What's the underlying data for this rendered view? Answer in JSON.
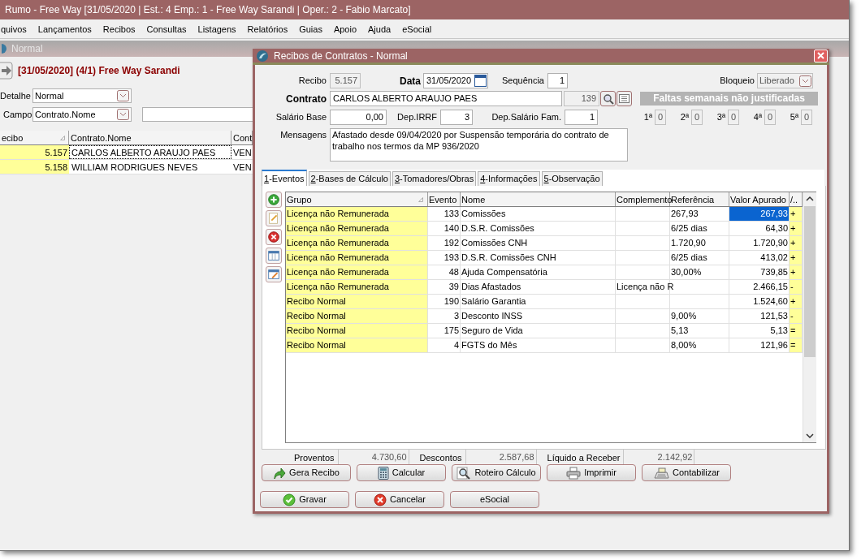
{
  "app": {
    "title": "Rumo - Free Way [31/05/2020 | Est.: 4 Emp.: 1 - Free Way Sarandi | Oper.: 2 - Fabio Marcato]",
    "menu": [
      "quivos",
      "Lançamentos",
      "Recibos",
      "Consultas",
      "Listagens",
      "Relatórios",
      "Guias",
      "Apoio",
      "Ajuda",
      "eSocial"
    ]
  },
  "background_window": {
    "title": "Normal",
    "heading": "[31/05/2020] (4/1) Free Way Sarandi",
    "detalhe": {
      "label": "Detalhe",
      "value": "Normal"
    },
    "campo": {
      "label": "Campo",
      "value": "Contrato.Nome"
    },
    "columns": [
      "ecibo",
      "Contrato.Nome",
      "Cont"
    ],
    "rows": [
      {
        "recibo": "5.157",
        "nome": "CARLOS ALBERTO ARAUJO PAES",
        "column_3": "VEN",
        "selected": true
      },
      {
        "recibo": "5.158",
        "nome": "WILLIAM RODRIGUES NEVES",
        "column_3": "VEN",
        "selected": false
      }
    ]
  },
  "dialog": {
    "title": "Recibos de Contratos - Normal",
    "recibo": {
      "label": "Recibo",
      "value": "5.157"
    },
    "data": {
      "label": "Data",
      "value": "31/05/2020"
    },
    "sequencia": {
      "label": "Sequência",
      "value": "1"
    },
    "bloqueio": {
      "label": "Bloqueio",
      "value": "Liberado"
    },
    "contrato": {
      "label": "Contrato",
      "value": "CARLOS ALBERTO ARAUJO PAES",
      "code": "139"
    },
    "faltas": {
      "title": "Faltas semanais não justificadas",
      "weeks": [
        {
          "label": "1ª",
          "value": "0"
        },
        {
          "label": "2ª",
          "value": "0"
        },
        {
          "label": "3ª",
          "value": "0"
        },
        {
          "label": "4ª",
          "value": "0"
        },
        {
          "label": "5ª",
          "value": "0"
        }
      ]
    },
    "salario_base": {
      "label": "Salário Base",
      "value": "0,00"
    },
    "dep_irrf": {
      "label": "Dep.IRRF",
      "value": "3"
    },
    "dep_salario_fam": {
      "label": "Dep.Salário Fam.",
      "value": "1"
    },
    "mensagens": {
      "label": "Mensagens",
      "value": "Afastado desde 09/04/2020 por Suspensão temporária do contrato de trabalho nos termos da MP 936/2020"
    },
    "tabs": [
      {
        "label": "1-Eventos",
        "selected": true
      },
      {
        "label": "2-Bases de Cálculo",
        "selected": false
      },
      {
        "label": "3-Tomadores/Obras",
        "selected": false
      },
      {
        "label": "4-Informações",
        "selected": false
      },
      {
        "label": "5-Observação",
        "selected": false
      }
    ],
    "grid": {
      "columns": [
        "Grupo",
        "Evento",
        "Nome",
        "Complemento",
        "Referência",
        "Valor Apurado",
        "/.."
      ],
      "rows": [
        {
          "grupo": "Licença não Remunerada",
          "evento": "133",
          "nome": "Comissões",
          "complemento": "",
          "referencia": "267,93",
          "valor": "267,93",
          "sinal": "+",
          "selected": true
        },
        {
          "grupo": "Licença não Remunerada",
          "evento": "140",
          "nome": "D.S.R. Comissões",
          "complemento": "",
          "referencia": "6/25 dias",
          "valor": "64,30",
          "sinal": "+",
          "selected": false
        },
        {
          "grupo": "Licença não Remunerada",
          "evento": "192",
          "nome": "Comissões CNH",
          "complemento": "",
          "referencia": "1.720,90",
          "valor": "1.720,90",
          "sinal": "+",
          "selected": false
        },
        {
          "grupo": "Licença não Remunerada",
          "evento": "193",
          "nome": "D.S.R. Comissões CNH",
          "complemento": "",
          "referencia": "6/25 dias",
          "valor": "413,02",
          "sinal": "+",
          "selected": false
        },
        {
          "grupo": "Licença não Remunerada",
          "evento": "48",
          "nome": "Ajuda Compensatória",
          "complemento": "",
          "referencia": "30,00%",
          "valor": "739,85",
          "sinal": "+",
          "selected": false
        },
        {
          "grupo": "Licença não Remunerada",
          "evento": "39",
          "nome": "Dias Afastados",
          "complemento": "Licença não R",
          "referencia": "",
          "valor": "2.466,15",
          "sinal": "-",
          "selected": false
        },
        {
          "grupo": "Recibo Normal",
          "evento": "190",
          "nome": "Salário Garantia",
          "complemento": "",
          "referencia": "",
          "valor": "1.524,60",
          "sinal": "+",
          "selected": false
        },
        {
          "grupo": "Recibo Normal",
          "evento": "3",
          "nome": "Desconto INSS",
          "complemento": "",
          "referencia": "9,00%",
          "valor": "121,53",
          "sinal": "-",
          "selected": false
        },
        {
          "grupo": "Recibo Normal",
          "evento": "175",
          "nome": "Seguro de Vida",
          "complemento": "",
          "referencia": "5,13",
          "valor": "5,13",
          "sinal": "=",
          "selected": false
        },
        {
          "grupo": "Recibo Normal",
          "evento": "4",
          "nome": "FGTS do Mês",
          "complemento": "",
          "referencia": "8,00%",
          "valor": "121,96",
          "sinal": "=",
          "selected": false
        }
      ]
    },
    "totals": [
      {
        "label": "Proventos",
        "value": "4.730,60"
      },
      {
        "label": "Descontos",
        "value": "2.587,68"
      },
      {
        "label": "Líquido a Receber",
        "value": "2.142,92"
      }
    ],
    "actions": [
      {
        "label": "Gera Recibo",
        "kind": "arrow"
      },
      {
        "label": "Calcular",
        "kind": "calculator"
      },
      {
        "label": "Roteiro Cálculo",
        "kind": "magnifier"
      },
      {
        "label": "Imprimir",
        "kind": "printer"
      },
      {
        "label": "Contabilizar",
        "kind": "register"
      }
    ],
    "buttons": [
      {
        "label": "Gravar",
        "kind": "ok"
      },
      {
        "label": "Cancelar",
        "kind": "cancel"
      },
      {
        "label": "eSocial",
        "kind": "plain"
      }
    ]
  }
}
